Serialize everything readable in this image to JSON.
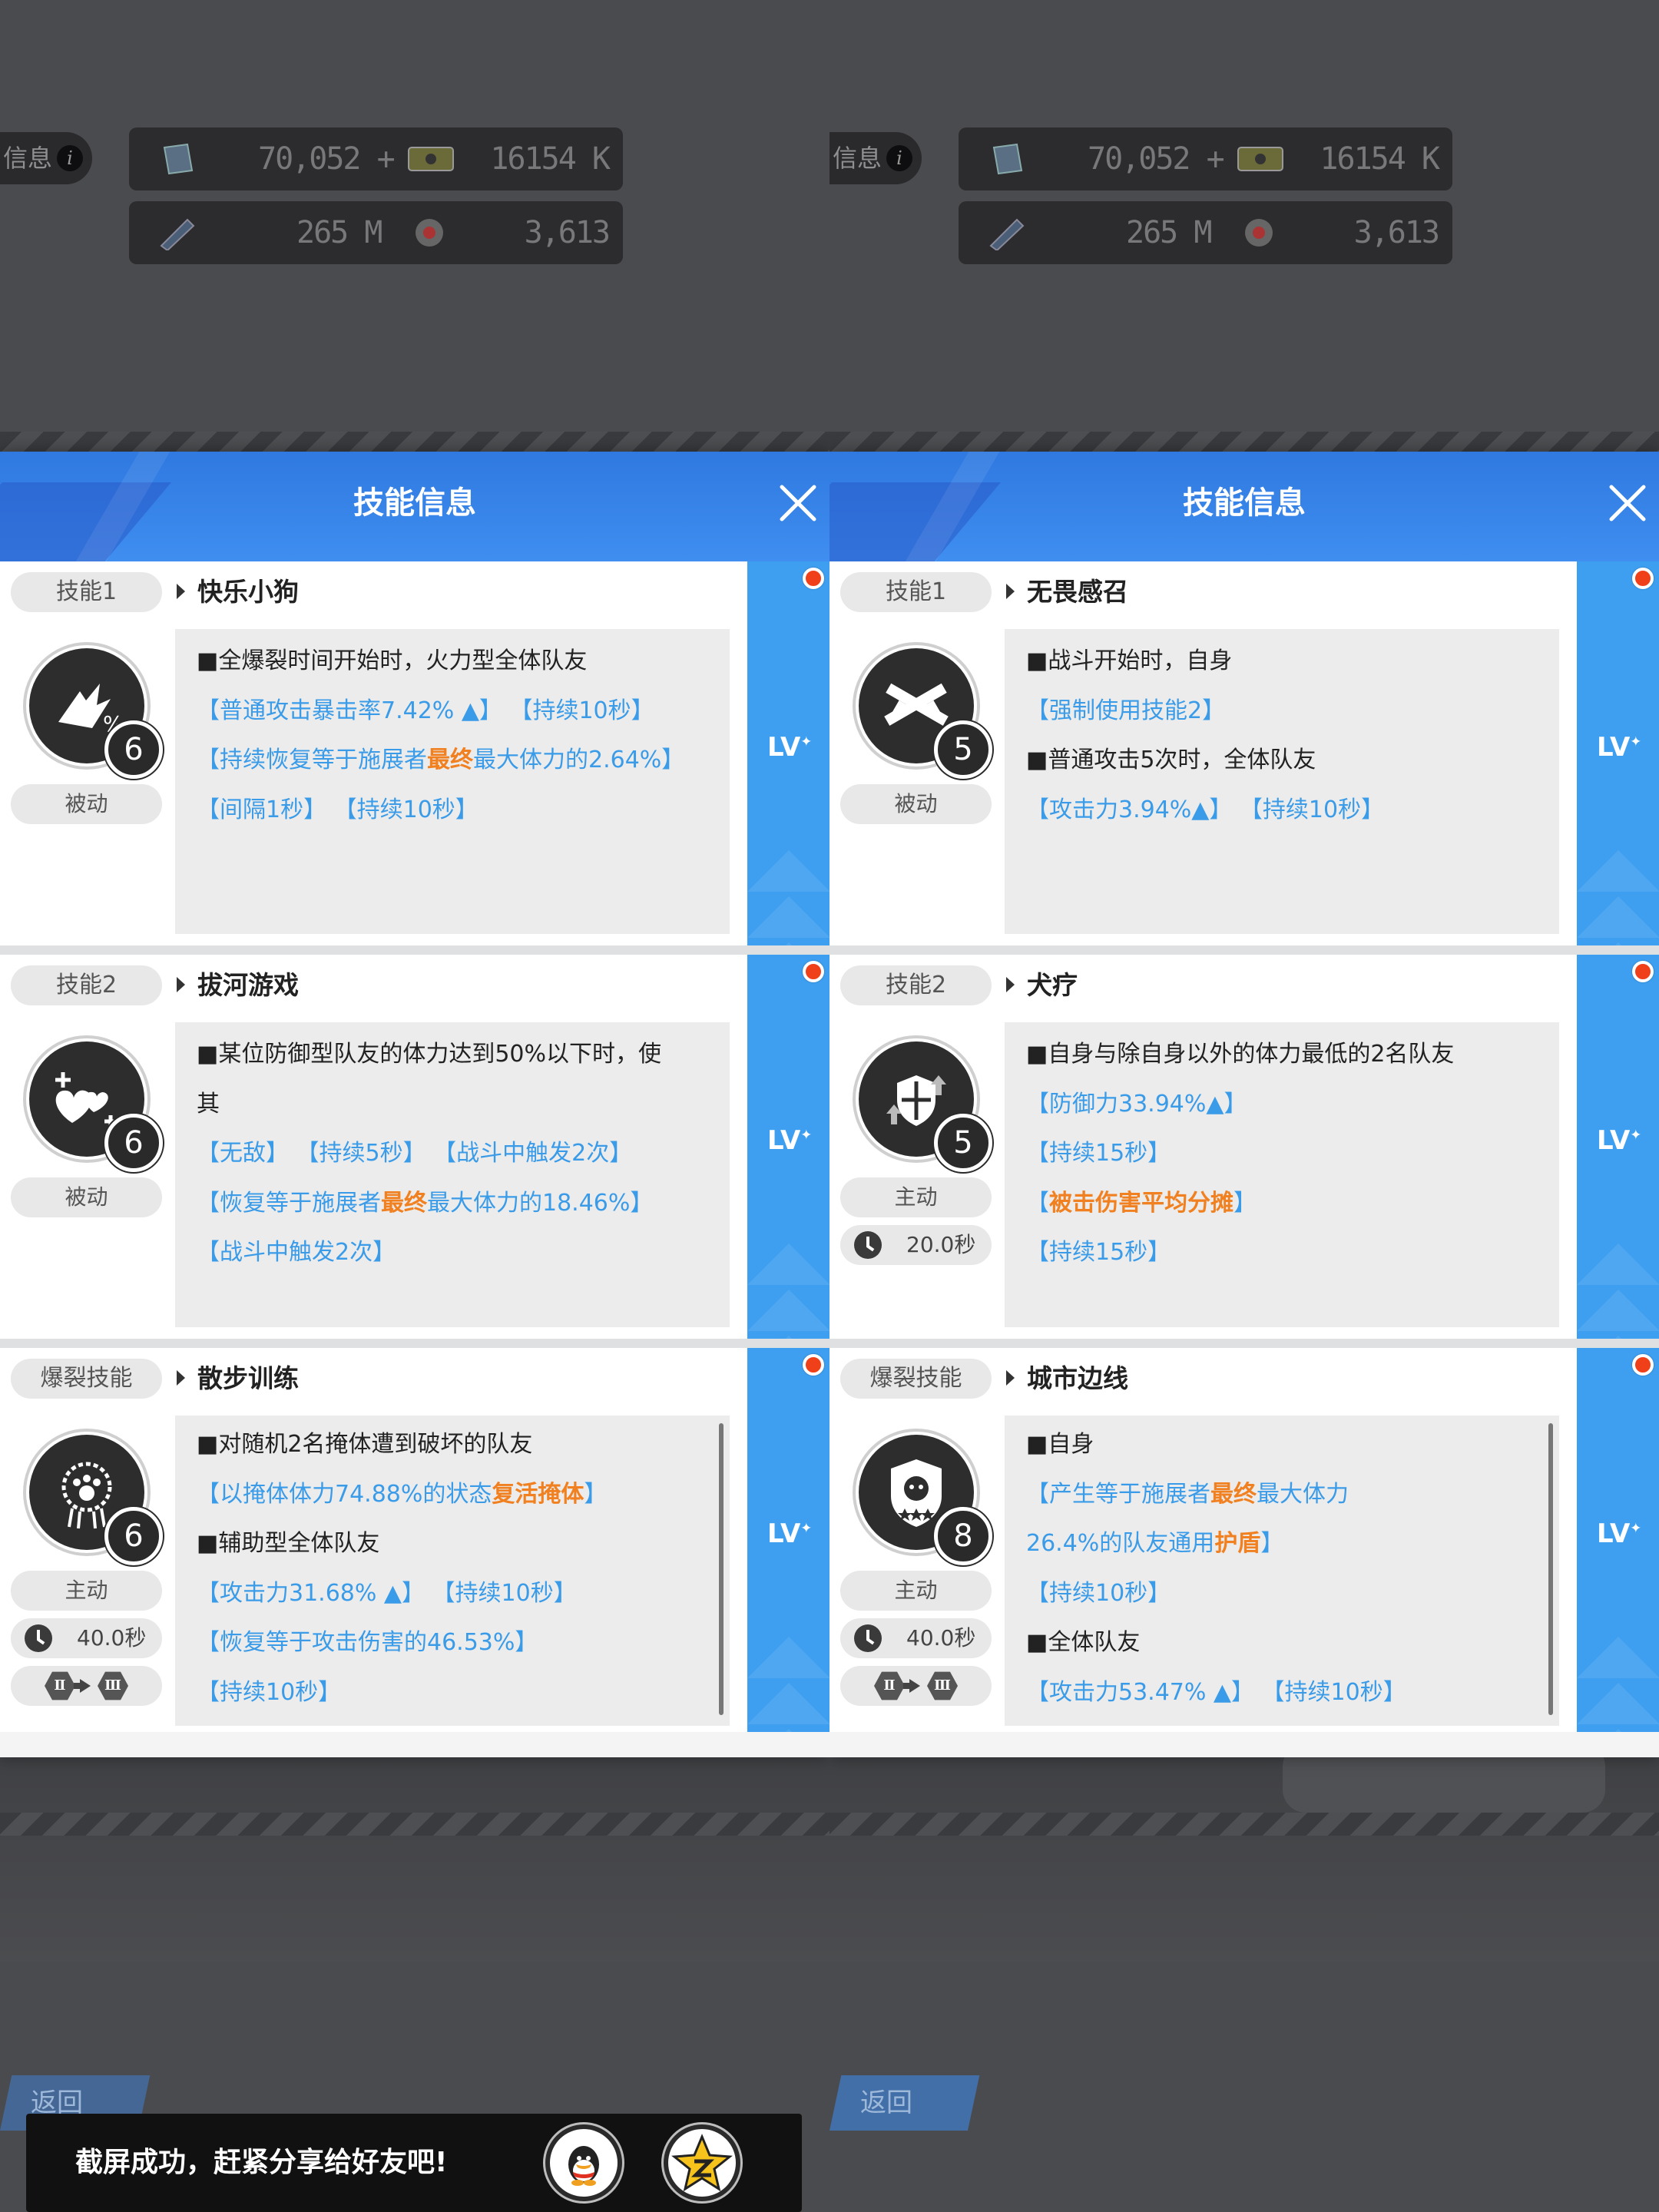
{
  "hud": {
    "info_tag": "信息",
    "res_crystal": "70,052 +",
    "res_cash": "16154 K",
    "res_parts": "265 M",
    "res_core": "3,613"
  },
  "dialog_title": "技能信息",
  "lv_label": "LV",
  "panels": [
    {
      "skills": [
        {
          "badge": "技能1",
          "name": "快乐小狗",
          "level": "6",
          "type": "被动",
          "icon": "burst-percent-icon",
          "lines": [
            {
              "c": "k",
              "parts": [
                {
                  "t": "■全爆裂时间开始时，火力型全体队友"
                }
              ]
            },
            {
              "c": "b",
              "parts": [
                {
                  "t": "【普通攻击暴击率7.42% ▲】 【持续10秒】"
                }
              ]
            },
            {
              "c": "b",
              "parts": [
                {
                  "t": "【持续恢复等于施展者"
                },
                {
                  "t": "最终",
                  "o": true
                },
                {
                  "t": "最大体力的2.64%】"
                }
              ]
            },
            {
              "c": "b",
              "parts": [
                {
                  "t": "【间隔1秒】 【持续10秒】"
                }
              ]
            }
          ]
        },
        {
          "badge": "技能2",
          "name": "拔河游戏",
          "level": "6",
          "type": "被动",
          "icon": "hearts-plus-icon",
          "lines": [
            {
              "c": "k",
              "parts": [
                {
                  "t": "■某位防御型队友的体力达到50%以下时，使"
                }
              ]
            },
            {
              "c": "k",
              "parts": [
                {
                  "t": "其"
                }
              ]
            },
            {
              "c": "b",
              "parts": [
                {
                  "t": "【无敌】 【持续5秒】 【战斗中触发2次】"
                }
              ]
            },
            {
              "c": "b",
              "parts": [
                {
                  "t": "【恢复等于施展者"
                },
                {
                  "t": "最终",
                  "o": true
                },
                {
                  "t": "最大体力的18.46%】"
                }
              ]
            },
            {
              "c": "b",
              "parts": [
                {
                  "t": "【战斗中触发2次】"
                }
              ]
            }
          ]
        },
        {
          "badge": "爆裂技能",
          "name": "散步训练",
          "level": "6",
          "type": "主动",
          "cooldown": "40.0秒",
          "evo": [
            "Ⅱ",
            "Ⅲ"
          ],
          "icon": "paw-medal-icon",
          "lines": [
            {
              "c": "k",
              "parts": [
                {
                  "t": "■对随机2名掩体遭到破坏的队友"
                }
              ]
            },
            {
              "c": "b",
              "parts": [
                {
                  "t": "【以掩体体力74.88%的状态"
                },
                {
                  "t": "复活掩体",
                  "o": true
                },
                {
                  "t": "】"
                }
              ]
            },
            {
              "c": "k",
              "parts": [
                {
                  "t": "■辅助型全体队友"
                }
              ]
            },
            {
              "c": "b",
              "parts": [
                {
                  "t": "【攻击力31.68% ▲】 【持续10秒】"
                }
              ]
            },
            {
              "c": "b",
              "parts": [
                {
                  "t": "【恢复等于攻击伤害的46.53%】"
                }
              ]
            },
            {
              "c": "b",
              "parts": [
                {
                  "t": "【持续10秒】"
                }
              ]
            }
          ]
        }
      ]
    },
    {
      "skills": [
        {
          "badge": "技能1",
          "name": "无畏感召",
          "level": "5",
          "type": "被动",
          "icon": "crossed-guns-icon",
          "lines": [
            {
              "c": "k",
              "parts": [
                {
                  "t": "■战斗开始时，自身"
                }
              ]
            },
            {
              "c": "b",
              "parts": [
                {
                  "t": "【强制使用技能2】"
                }
              ]
            },
            {
              "c": "k",
              "parts": [
                {
                  "t": "■普通攻击5次时，全体队友"
                }
              ]
            },
            {
              "c": "b",
              "parts": [
                {
                  "t": "【攻击力3.94%▲】 【持续10秒】"
                }
              ]
            }
          ]
        },
        {
          "badge": "技能2",
          "name": "犬疗",
          "level": "5",
          "type": "主动",
          "cooldown": "20.0秒",
          "icon": "shield-arrows-icon",
          "lines": [
            {
              "c": "k",
              "parts": [
                {
                  "t": "■自身与除自身以外的体力最低的2名队友"
                }
              ]
            },
            {
              "c": "b",
              "parts": [
                {
                  "t": "【防御力33.94%▲】"
                }
              ]
            },
            {
              "c": "b",
              "parts": [
                {
                  "t": "【持续15秒】"
                }
              ]
            },
            {
              "c": "b",
              "parts": [
                {
                  "t": "【"
                },
                {
                  "t": "被击伤害平均分摊",
                  "o": true
                },
                {
                  "t": "】"
                }
              ]
            },
            {
              "c": "b",
              "parts": [
                {
                  "t": "【持续15秒】"
                }
              ]
            }
          ]
        },
        {
          "badge": "爆裂技能",
          "name": "城市边线",
          "level": "8",
          "type": "主动",
          "cooldown": "40.0秒",
          "evo": [
            "Ⅱ",
            "Ⅲ"
          ],
          "icon": "police-badge-icon",
          "lines": [
            {
              "c": "k",
              "parts": [
                {
                  "t": "■自身"
                }
              ]
            },
            {
              "c": "b",
              "parts": [
                {
                  "t": "【产生等于施展者"
                },
                {
                  "t": "最终",
                  "o": true
                },
                {
                  "t": "最大体力"
                }
              ]
            },
            {
              "c": "b",
              "parts": [
                {
                  "t": "26.4%的队友通用"
                },
                {
                  "t": "护盾",
                  "o": true
                },
                {
                  "t": "】"
                }
              ]
            },
            {
              "c": "b",
              "parts": [
                {
                  "t": "【持续10秒】"
                }
              ]
            },
            {
              "c": "k",
              "parts": [
                {
                  "t": "■全体队友"
                }
              ]
            },
            {
              "c": "b",
              "parts": [
                {
                  "t": "【攻击力53.47% ▲】 【持续10秒】"
                }
              ]
            }
          ]
        }
      ]
    }
  ],
  "return_label": "返回",
  "toast": {
    "message": "截屏成功，赶紧分享给好友吧!",
    "share_buttons": [
      "qq-share-icon",
      "qzone-share-icon"
    ]
  },
  "colors": {
    "accent_blue": "#3e9ff0",
    "highlight_orange": "#f08020",
    "text_blue": "#3a9be8"
  }
}
